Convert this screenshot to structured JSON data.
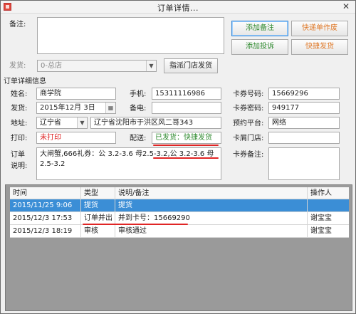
{
  "window": {
    "title": "订单详情...",
    "close": "✕"
  },
  "remark": {
    "label": "备注:",
    "value": ""
  },
  "buttons": {
    "add_remark": "添加备注",
    "add_complaint": "添加投诉",
    "quick_invalid": "快递单作废",
    "quick_ship": "快捷发货",
    "assign_store": "指派门店发货"
  },
  "ship": {
    "label": "发货:",
    "value": "0-总店"
  },
  "section_title": "订单详细信息",
  "fields": {
    "name_label": "姓名:",
    "name": "商学院",
    "phone_label": "手机:",
    "phone": "15311116986",
    "card_no_label": "卡券号码:",
    "card_no": "15669296",
    "ship_date_label": "发货:",
    "ship_date": "2015年12月  3日",
    "backup_phone_label": "备电:",
    "backup_phone": "",
    "card_pwd_label": "卡券密码:",
    "card_pwd": "949177",
    "address_label": "地址:",
    "province": "辽宁省",
    "address": "辽宁省沈阳市于洪区风二哥343",
    "platform_label": "预约平台:",
    "platform": "网络",
    "print_label": "打印:",
    "print_status": "未打印",
    "delivery_label": "配送:",
    "delivery": "已发货：快捷发货",
    "store_label": "卡屑门店:",
    "store": "",
    "order_desc_label1": "订单",
    "order_desc_label2": "说明:",
    "order_desc": "大闸蟹,666礼券：公 3.2-3.6 母2.5-3.2,公 3.2-3.6 母2.5-3.2",
    "card_remark_label": "卡券备注:",
    "card_remark": ""
  },
  "table": {
    "headers": [
      "时间",
      "类型",
      "说明/备注",
      "操作人"
    ],
    "rows": [
      {
        "time": "2015/11/25 9:06",
        "type": "提货",
        "note": "提货",
        "operator": "",
        "selected": true
      },
      {
        "time": "2015/12/3 17:53",
        "type": "订单并出",
        "note": "并到卡号：15669290",
        "operator": "谢宝宝",
        "selected": false
      },
      {
        "time": "2015/12/3 18:19",
        "type": "审核",
        "note": "审核通过",
        "operator": "谢宝宝",
        "selected": false
      }
    ]
  },
  "colors": {
    "red": "#e02525",
    "green": "#2f8a2f",
    "orange": "#e07a2a",
    "selection": "#3b8ed6"
  }
}
